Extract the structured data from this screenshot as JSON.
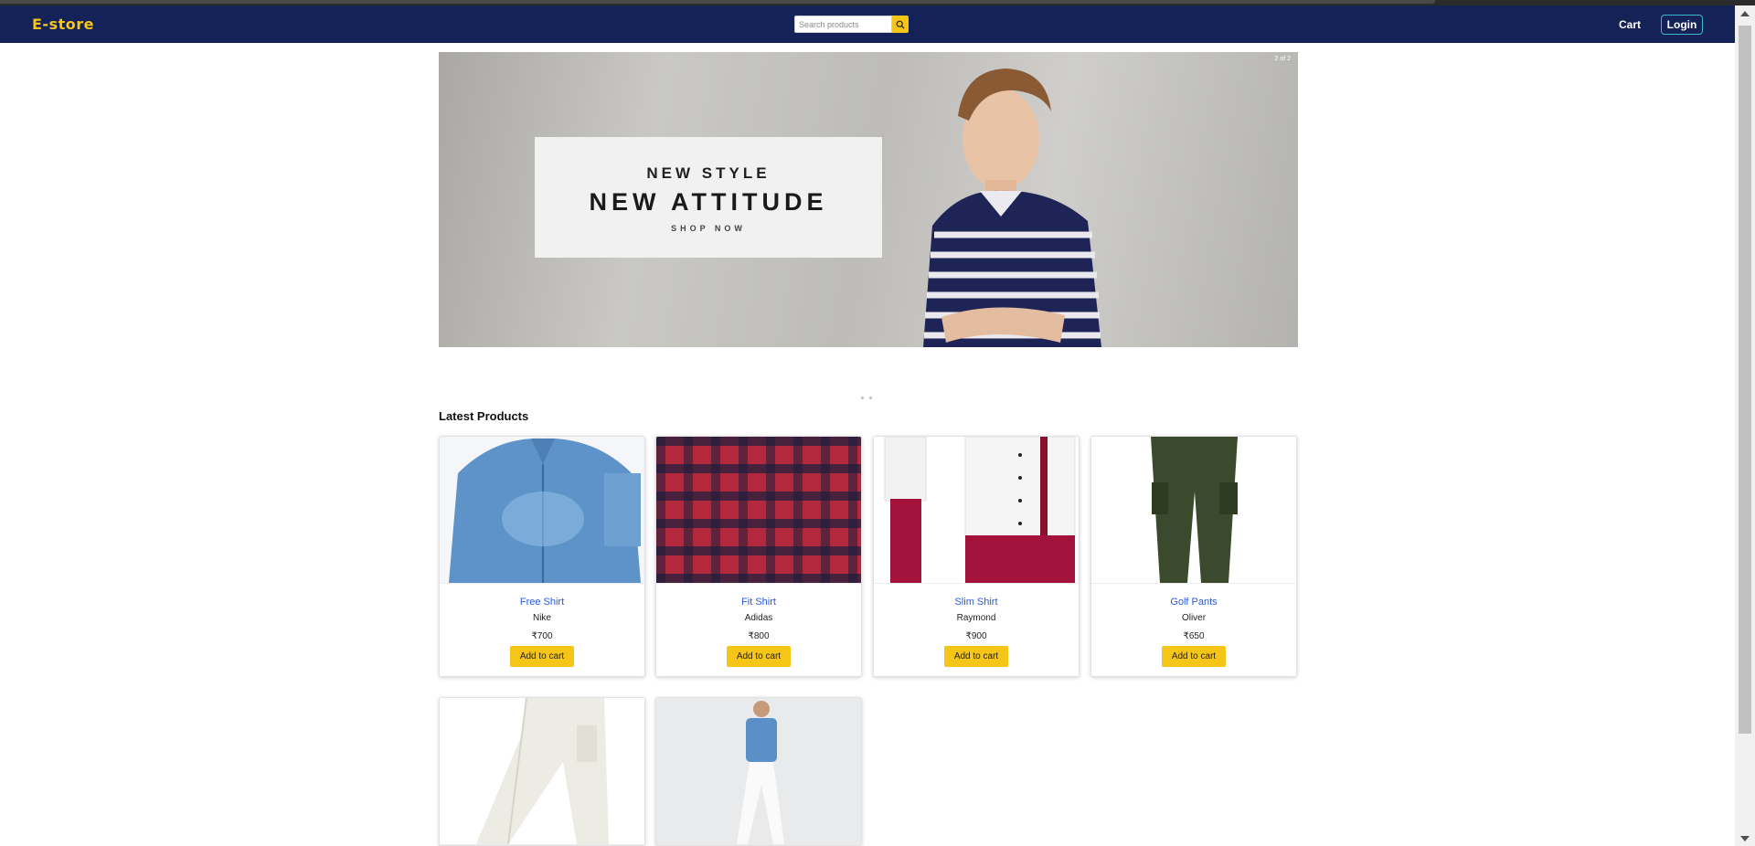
{
  "navbar": {
    "brand": "E-store",
    "search_placeholder": "Search products",
    "cart_label": "Cart",
    "login_label": "Login"
  },
  "carousel": {
    "counter": "2 of 2",
    "line1": "NEW STYLE",
    "line2": "NEW ATTITUDE",
    "line3": "SHOP NOW"
  },
  "section_title": "Latest Products",
  "products": [
    {
      "name": "Free Shirt",
      "brand": "Nike",
      "price": "₹700",
      "button": "Add to cart"
    },
    {
      "name": "Fit Shirt",
      "brand": "Adidas",
      "price": "₹800",
      "button": "Add to cart"
    },
    {
      "name": "Slim Shirt",
      "brand": "Raymond",
      "price": "₹900",
      "button": "Add to cart"
    },
    {
      "name": "Golf Pants",
      "brand": "Oliver",
      "price": "₹650",
      "button": "Add to cart"
    }
  ],
  "colors": {
    "navbar": "#142257",
    "accent": "#f5c518",
    "link": "#2a5bd7"
  }
}
